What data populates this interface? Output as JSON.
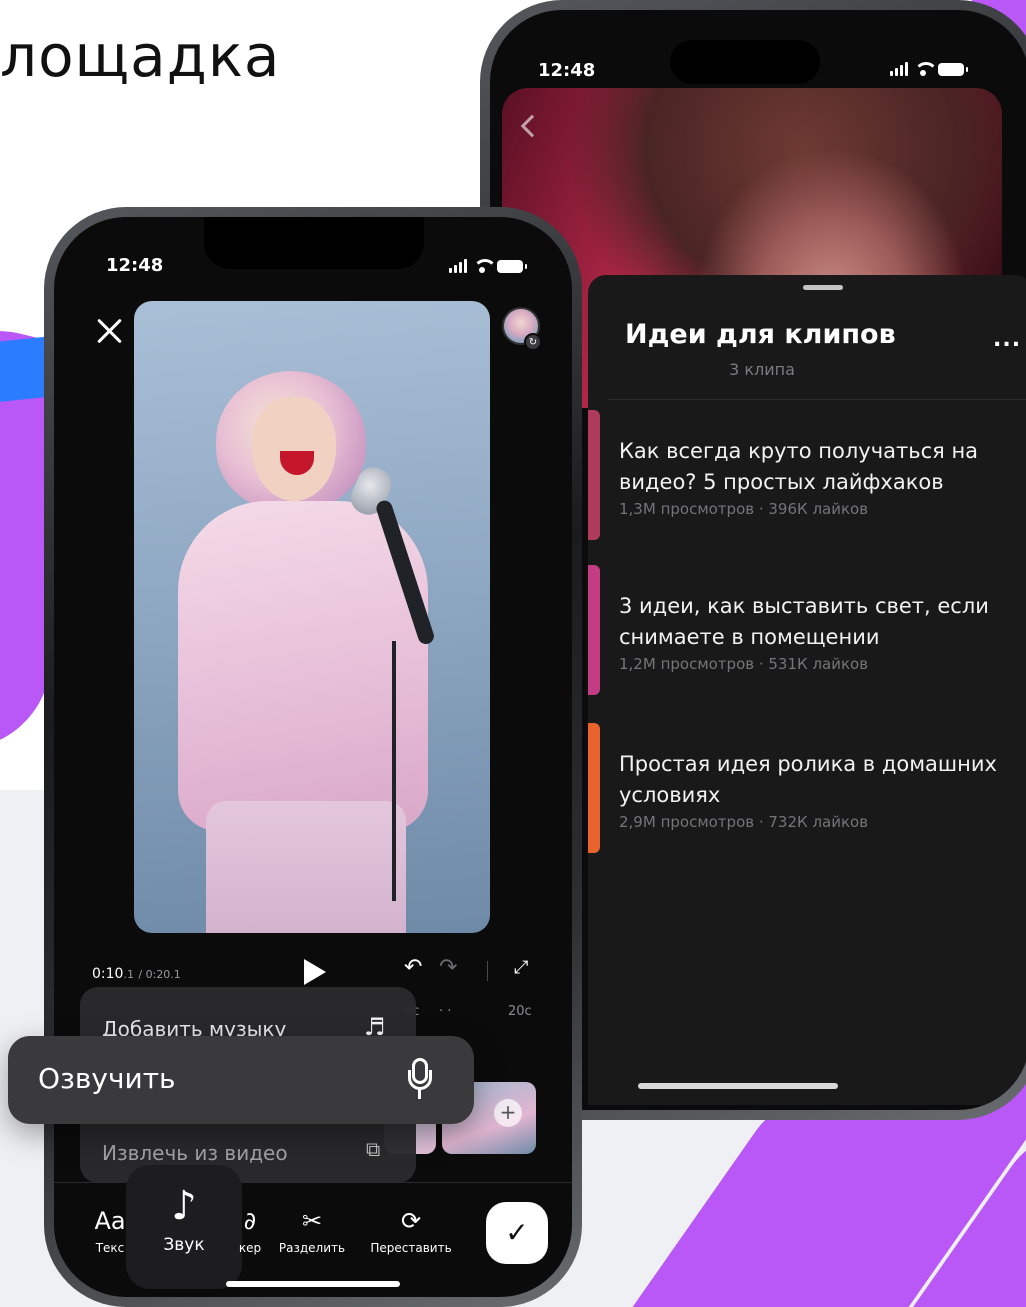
{
  "headline": "лощадка",
  "back_phone": {
    "status_time": "12:48",
    "sheet": {
      "title": "Идеи для клипов",
      "subtitle": "3 клипа",
      "more": "...",
      "clips": [
        {
          "title": "Как всегда круто получаться на видео? 5 простых лайфхаков",
          "meta": "1,3М просмотров · 396К лайков",
          "thumb_color": "#b03a5a"
        },
        {
          "title": "3 идеи, как выставить свет, если снимаете в помещении",
          "meta": "1,2М просмотров · 531К лайков",
          "thumb_color": "#c43c83"
        },
        {
          "title": "Простая идея ролика в домашних условиях",
          "meta": "2,9М просмотров · 732К лайков",
          "thumb_color": "#e8642c"
        }
      ]
    }
  },
  "front_phone": {
    "status_time": "12:48",
    "playback": {
      "current": "0:10",
      "current_fraction": ".1",
      "total": "/ 0:20.1",
      "undo_icon": "undo-icon",
      "redo_icon": "redo-icon",
      "expand_icon": "expand-icon"
    },
    "ruler": {
      "mark_a": "5с",
      "dots": "·   ·",
      "mark_b": "20с"
    },
    "audio_menu": {
      "items": [
        {
          "label": "Добавить музыку",
          "icon": "music-note-icon"
        },
        {
          "label": "Извлечь из видео",
          "icon": "extract-video-icon"
        }
      ]
    },
    "voice_over": {
      "label": "Озвучить",
      "icon": "microphone-icon"
    },
    "toolbar": {
      "text_icon": "Aa",
      "text_label": "Текс",
      "sound_icon": "♪",
      "sound_label": "Звук",
      "sticker_label": "кер",
      "split_icon": "✂",
      "split_label": "Разделить",
      "rearrange_icon": "⟳",
      "rearrange_label": "Переставить",
      "confirm_icon": "✓"
    }
  },
  "colors": {
    "accent_purple": "#b958f6",
    "accent_blue": "#2b7cff",
    "sheet_bg": "#19191a",
    "menu_bg": "#2b2b2d"
  }
}
